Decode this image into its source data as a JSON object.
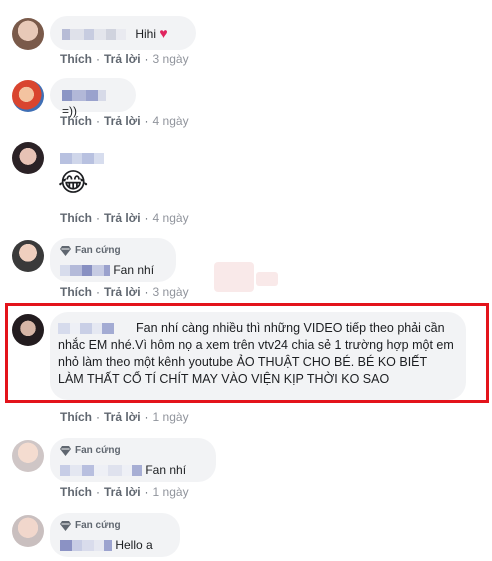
{
  "actions": {
    "like": "Thích",
    "reply": "Trả lời",
    "separator": "·"
  },
  "badge_label": "Fan cứng",
  "comments": [
    {
      "text": "Hihi",
      "emoji": "♥",
      "time": "3 ngày"
    },
    {
      "text": "=))",
      "time": "4 ngày"
    },
    {
      "emoji": "😂",
      "time": "4 ngày"
    },
    {
      "text": "Fan nhí",
      "time": "3 ngày"
    },
    {
      "text": "Fan nhí càng nhiều thì những VIDEO tiếp theo phải cần nhắc EM nhé.Vì hôm nọ a xem trên vtv24 chia sẻ 1 trường hợp một em nhỏ làm theo một kênh youtube ẢO THUẬT CHO BÉ. BÉ KO BIẾT LÀM THẤT CỔ TÍ CHÍT MAY VÀO VIỆN KỊP THỜI KO SAO",
      "time": "1 ngày"
    },
    {
      "text": "Fan nhí",
      "time": "1 ngày"
    },
    {
      "text": "Hello a"
    }
  ],
  "colors": {
    "highlight": "#e3131b",
    "bubble": "#f2f3f5",
    "meta": "#606770"
  }
}
